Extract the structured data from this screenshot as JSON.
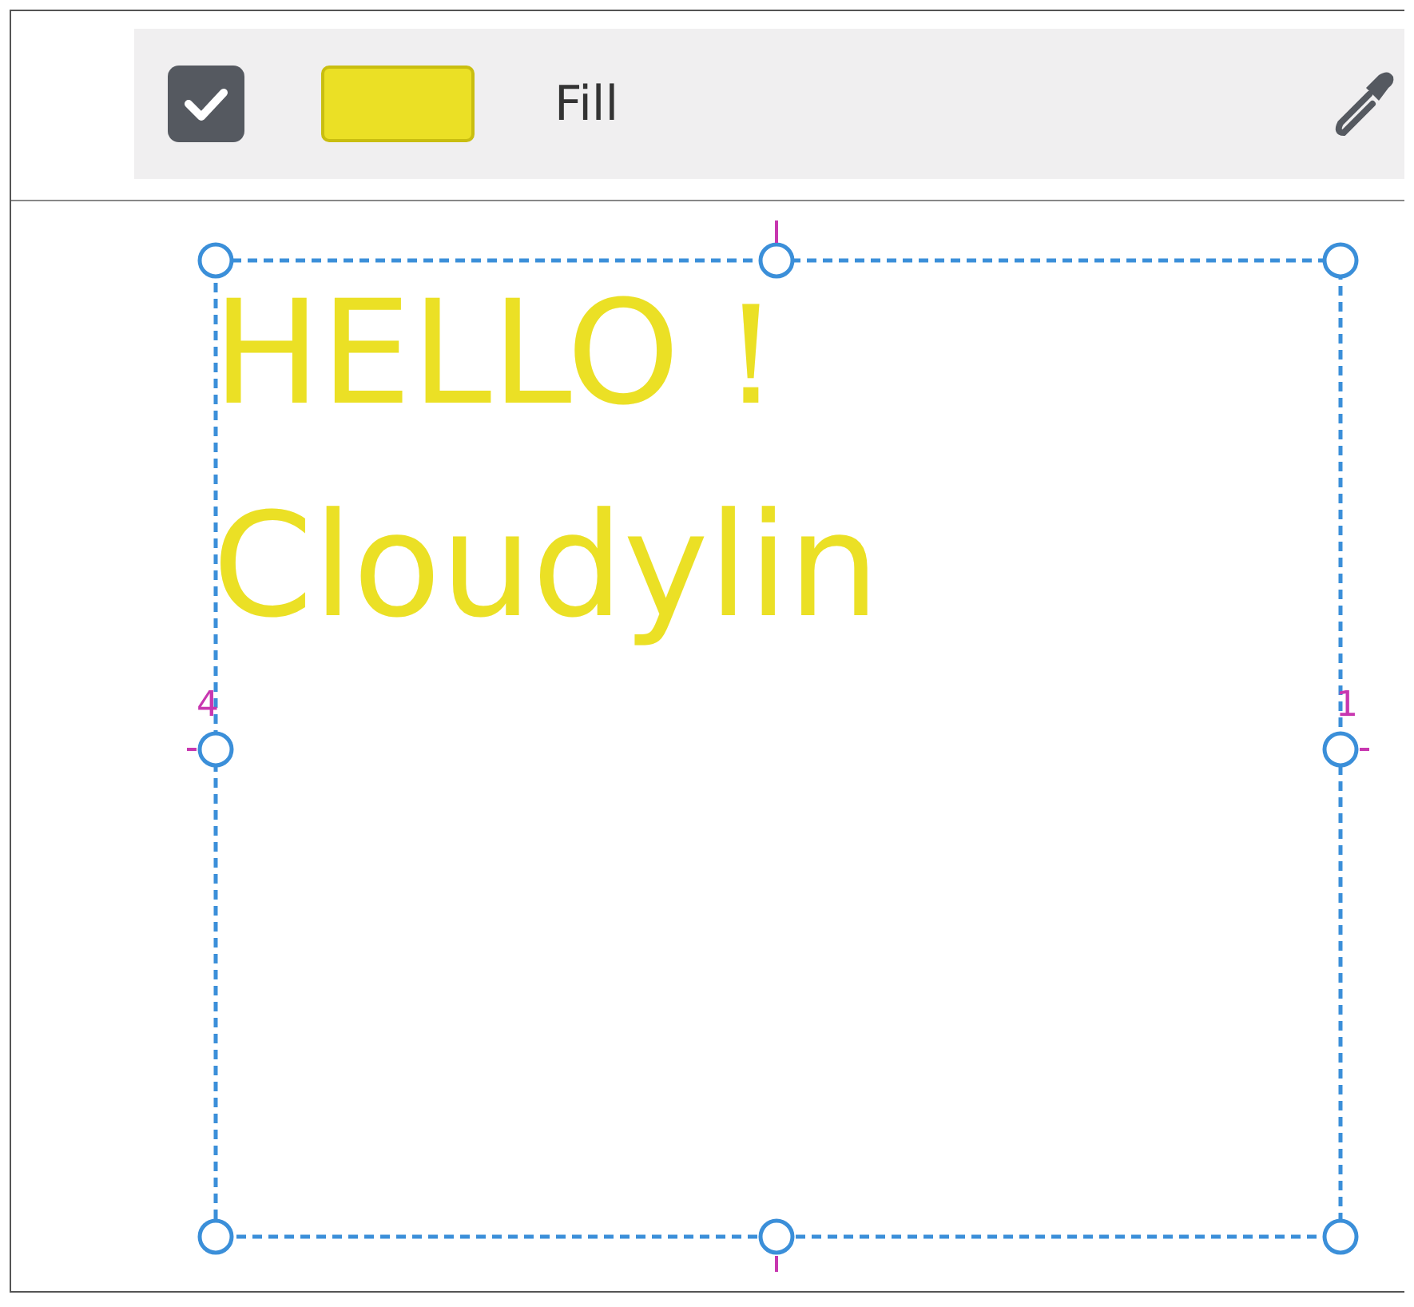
{
  "toolbar": {
    "fill_enabled": {
      "checked": true
    },
    "fill_swatch": {
      "color": "#ebe025"
    },
    "label": "Fill"
  },
  "canvas": {
    "text_lines": [
      "HELLO！",
      "Cloudylin"
    ],
    "guide_labels": [
      "4",
      "1"
    ]
  }
}
